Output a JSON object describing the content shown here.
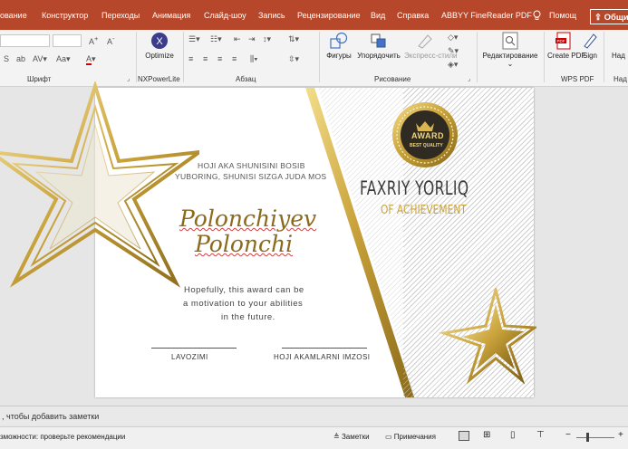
{
  "menu": {
    "items": [
      "ование",
      "Конструктор",
      "Переходы",
      "Анимация",
      "Слайд-шоу",
      "Запись",
      "Рецензирование",
      "Вид",
      "Справка",
      "ABBYY FineReader PDF",
      "Помощ"
    ],
    "share_label": "Общи"
  },
  "ribbon": {
    "groups": [
      "Шрифт",
      "NXPowerLite",
      "Абзац",
      "Рисование",
      "WPS PDF",
      "Над"
    ],
    "buttons": {
      "optimize": "Optimize",
      "shapes": "Фигуры",
      "arrange": "Упорядочить",
      "express": "Экспресс-стили",
      "editing": "Редактирование",
      "create_pdf": "Create PDF",
      "sign": "Sign",
      "nad": "Над"
    }
  },
  "slide": {
    "title": "FAXRIY YORLIQ",
    "subtitle": "OF ACHIEVEMENT",
    "badge_top": "AWARD",
    "badge_bottom": "BEST QUALITY",
    "intro_line1": "HOJI AKA SHUNISINI BOSIB",
    "intro_line2": "YUBORING, SHUNISI SIZGA JUDA MOS",
    "name_line1": "Polonchiyev",
    "name_line2": "Polonchi",
    "message_line1": "Hopefully, this award can be",
    "message_line2": "a motivation to your abilities",
    "message_line3": "in the future.",
    "sig_left": "LAVOZIMI",
    "sig_right": "HOJI AKAMLARNI IMZOSI"
  },
  "notes_placeholder": ", чтобы добавить заметки",
  "status": {
    "accessibility": "зможности: проверьте рекомендации",
    "notes": "Заметки",
    "comments": "Примечания"
  },
  "colors": {
    "accent": "#b7472a",
    "gold": "#c9a23a",
    "title": "#3a3a3a",
    "name": "#8b6a1c"
  }
}
